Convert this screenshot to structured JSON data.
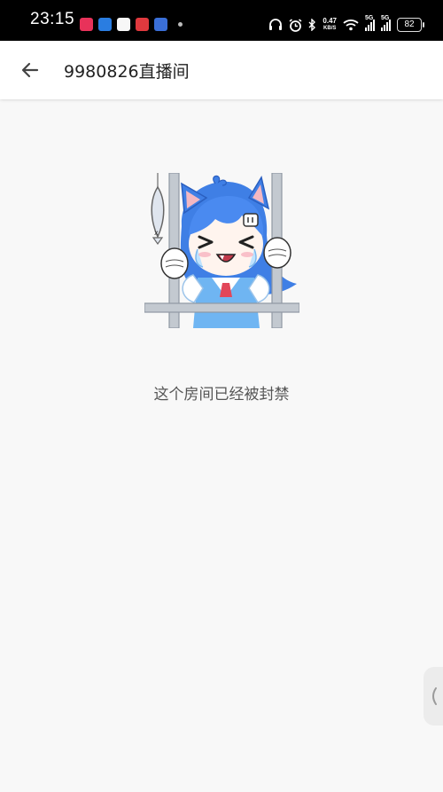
{
  "status_bar": {
    "time": "23:15",
    "net_speed_value": "0.47",
    "net_speed_unit": "KB/S",
    "signal1_label": "5G",
    "signal2_label": "5G",
    "battery": "82",
    "notification_icons": [
      "app-notification-icon",
      "bluetooth-app-icon",
      "app-notification-icon",
      "app-notification-icon",
      "app-notification-icon"
    ]
  },
  "header": {
    "title": "9980826直播间",
    "back_icon": "arrow-left-icon"
  },
  "main": {
    "image": "crying-catgirl-behind-bars-illustration",
    "message": "这个房间已经被封禁"
  },
  "edge_handle": {
    "icon": "chevron-left-icon"
  },
  "colors": {
    "status_bar_bg": "#000000",
    "app_bar_bg": "#ffffff",
    "page_bg": "#f8f8f8",
    "message_text": "#555555"
  }
}
